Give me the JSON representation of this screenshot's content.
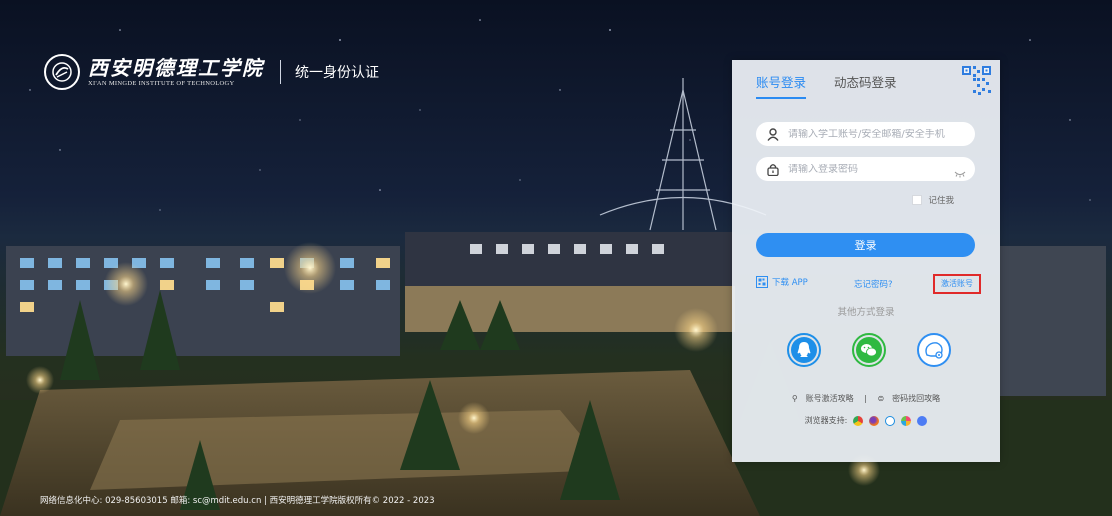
{
  "brand": {
    "school_cn": "西安明德理工学院",
    "school_en": "XI'AN MINGDE INSTITUTE OF TECHNOLOGY",
    "system_title": "统一身份认证"
  },
  "login": {
    "tabs": [
      {
        "label": "账号登录",
        "active": true
      },
      {
        "label": "动态码登录",
        "active": false
      }
    ],
    "username_placeholder": "请输入学工账号/安全邮箱/安全手机",
    "password_placeholder": "请输入登录密码",
    "remember_label": "记住我",
    "submit_label": "登录",
    "download_app": "下载 APP",
    "forgot_password": "忘记密码?",
    "activate_account": "激活账号",
    "other_methods": "其他方式登录",
    "guide_activate": "账号激活攻略",
    "guide_recover": "密码找回攻略",
    "browser_support": "浏览器支持:"
  },
  "socials": [
    {
      "name": "qq-icon",
      "color": "#1e8fe8"
    },
    {
      "name": "wechat-icon",
      "color": "#2fb941"
    },
    {
      "name": "face-login-icon",
      "color": "#2f8ff2"
    }
  ],
  "browsers": [
    {
      "name": "chrome-icon",
      "color": "#e5413a"
    },
    {
      "name": "firefox-icon",
      "color": "#f2741d"
    },
    {
      "name": "ie-icon",
      "color": "#1c8de0"
    },
    {
      "name": "safari-icon",
      "color": "#f34a74"
    },
    {
      "name": "sogou-icon",
      "color": "#4d7cf4"
    }
  ],
  "colors": {
    "accent": "#2f8ff2",
    "highlight_border": "#e02a2a"
  },
  "footer": {
    "text": "网络信息化中心: 029-85603015 邮箱: sc@mdit.edu.cn | 西安明德理工学院版权所有© 2022 - 2023"
  }
}
